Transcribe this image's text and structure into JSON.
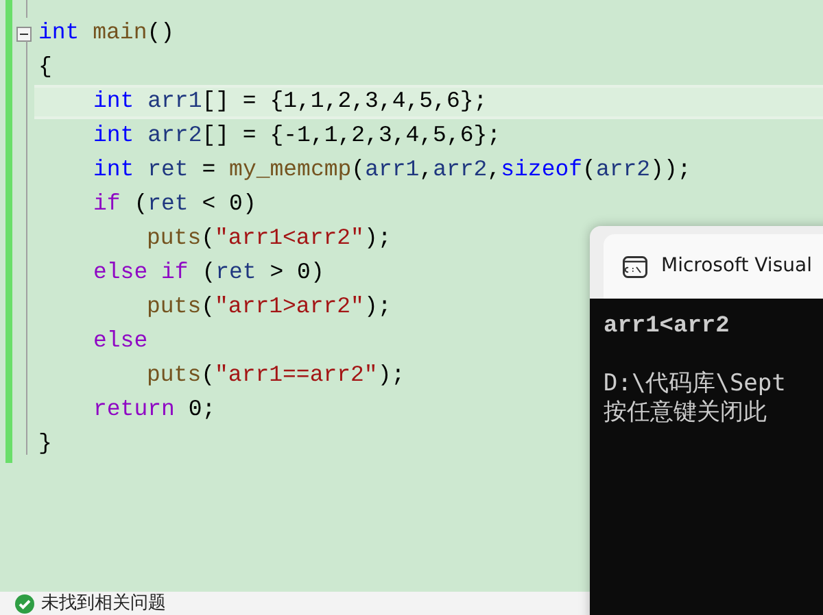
{
  "editor": {
    "fold_toggle": {
      "expanded": true
    },
    "lines": [
      {
        "kind": "top",
        "current": false,
        "tokens": [
          {
            "text": "int ",
            "kind": "type"
          },
          {
            "text": "main",
            "kind": "function"
          },
          {
            "text": "()",
            "kind": "punct"
          }
        ]
      },
      {
        "kind": "top",
        "current": false,
        "tokens": [
          {
            "text": "{",
            "kind": "punct"
          }
        ]
      },
      {
        "kind": "body",
        "current": true,
        "tokens": [
          {
            "text": "int ",
            "kind": "type"
          },
          {
            "text": "arr1",
            "kind": "variable"
          },
          {
            "text": "[] = {1,1,2,3,4,5,6};",
            "kind": "punct"
          }
        ]
      },
      {
        "kind": "body",
        "current": false,
        "tokens": [
          {
            "text": "int ",
            "kind": "type"
          },
          {
            "text": "arr2",
            "kind": "variable"
          },
          {
            "text": "[] = {-1,1,2,3,4,5,6};",
            "kind": "punct"
          }
        ]
      },
      {
        "kind": "body",
        "current": false,
        "tokens": [
          {
            "text": "int ",
            "kind": "type"
          },
          {
            "text": "ret",
            "kind": "variable"
          },
          {
            "text": " = ",
            "kind": "punct"
          },
          {
            "text": "my_memcmp",
            "kind": "function"
          },
          {
            "text": "(",
            "kind": "punct"
          },
          {
            "text": "arr1",
            "kind": "variable"
          },
          {
            "text": ",",
            "kind": "punct"
          },
          {
            "text": "arr2",
            "kind": "variable"
          },
          {
            "text": ",",
            "kind": "punct"
          },
          {
            "text": "sizeof",
            "kind": "type"
          },
          {
            "text": "(",
            "kind": "punct"
          },
          {
            "text": "arr2",
            "kind": "variable"
          },
          {
            "text": "));",
            "kind": "punct"
          }
        ]
      },
      {
        "kind": "body",
        "current": false,
        "tokens": [
          {
            "text": "if",
            "kind": "control"
          },
          {
            "text": " (",
            "kind": "punct"
          },
          {
            "text": "ret",
            "kind": "variable"
          },
          {
            "text": " < 0)",
            "kind": "punct"
          }
        ]
      },
      {
        "kind": "nested",
        "current": false,
        "tokens": [
          {
            "text": "puts",
            "kind": "function"
          },
          {
            "text": "(",
            "kind": "punct"
          },
          {
            "text": "\"arr1<arr2\"",
            "kind": "string"
          },
          {
            "text": ");",
            "kind": "punct"
          }
        ]
      },
      {
        "kind": "body",
        "current": false,
        "tokens": [
          {
            "text": "else if",
            "kind": "control"
          },
          {
            "text": " (",
            "kind": "punct"
          },
          {
            "text": "ret",
            "kind": "variable"
          },
          {
            "text": " > 0)",
            "kind": "punct"
          }
        ]
      },
      {
        "kind": "nested",
        "current": false,
        "tokens": [
          {
            "text": "puts",
            "kind": "function"
          },
          {
            "text": "(",
            "kind": "punct"
          },
          {
            "text": "\"arr1>arr2\"",
            "kind": "string"
          },
          {
            "text": ");",
            "kind": "punct"
          }
        ]
      },
      {
        "kind": "body",
        "current": false,
        "tokens": [
          {
            "text": "else",
            "kind": "control"
          }
        ]
      },
      {
        "kind": "nested",
        "current": false,
        "tokens": [
          {
            "text": "puts",
            "kind": "function"
          },
          {
            "text": "(",
            "kind": "punct"
          },
          {
            "text": "\"arr1==arr2\"",
            "kind": "string"
          },
          {
            "text": ");",
            "kind": "punct"
          }
        ]
      },
      {
        "kind": "body",
        "current": false,
        "tokens": [
          {
            "text": "return",
            "kind": "control"
          },
          {
            "text": " 0;",
            "kind": "punct"
          }
        ]
      },
      {
        "kind": "top",
        "current": false,
        "tokens": [
          {
            "text": "}",
            "kind": "punct"
          }
        ]
      }
    ]
  },
  "status_bar": {
    "text": "未找到相关问题"
  },
  "console": {
    "title": "Microsoft Visual",
    "lines": [
      "arr1<arr2",
      "D:\\代码库\\Sept",
      "按任意键关闭此"
    ]
  }
}
